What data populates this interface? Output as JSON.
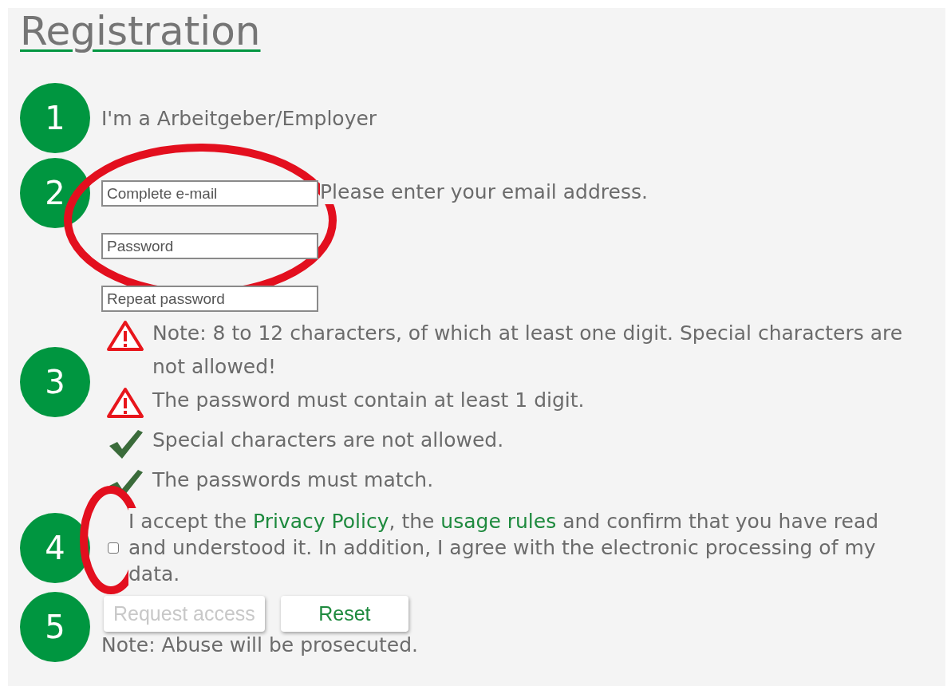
{
  "title": "Registration",
  "steps": [
    {
      "number": "1",
      "kind": "text",
      "text": "I'm a Arbeitgeber/Employer"
    },
    {
      "number": "2",
      "kind": "fields",
      "highlighted": true,
      "hint": "Please enter your email address.",
      "fields": [
        {
          "placeholder": "Complete e-mail"
        },
        {
          "placeholder": "Password"
        },
        {
          "placeholder": "Repeat password"
        }
      ]
    },
    {
      "number": "3",
      "kind": "messages",
      "messages": [
        {
          "kind": "warning",
          "text": "Note: 8 to 12 characters, of which at least one digit. Special characters are not allowed!"
        },
        {
          "kind": "warning",
          "text": "The password must contain at least 1 digit."
        },
        {
          "kind": "ok",
          "text": "Special characters are not allowed."
        },
        {
          "kind": "ok",
          "text": "The passwords must match."
        }
      ]
    },
    {
      "number": "4",
      "kind": "consent",
      "highlighted": true,
      "checked": false,
      "parts": [
        {
          "kind": "text",
          "text": "I accept the "
        },
        {
          "kind": "link",
          "text": "Privacy Policy"
        },
        {
          "kind": "text",
          "text": ", the "
        },
        {
          "kind": "link",
          "text": "usage rules"
        },
        {
          "kind": "text",
          "text": " and confirm that you have read and understood it. In addition, I agree with the electronic processing of my data."
        }
      ]
    },
    {
      "number": "5",
      "kind": "actions",
      "buttons": [
        {
          "label": "Request access",
          "disabled": true
        },
        {
          "label": "Reset",
          "disabled": false
        }
      ],
      "note": "Note: Abuse will be prosecuted."
    }
  ]
}
